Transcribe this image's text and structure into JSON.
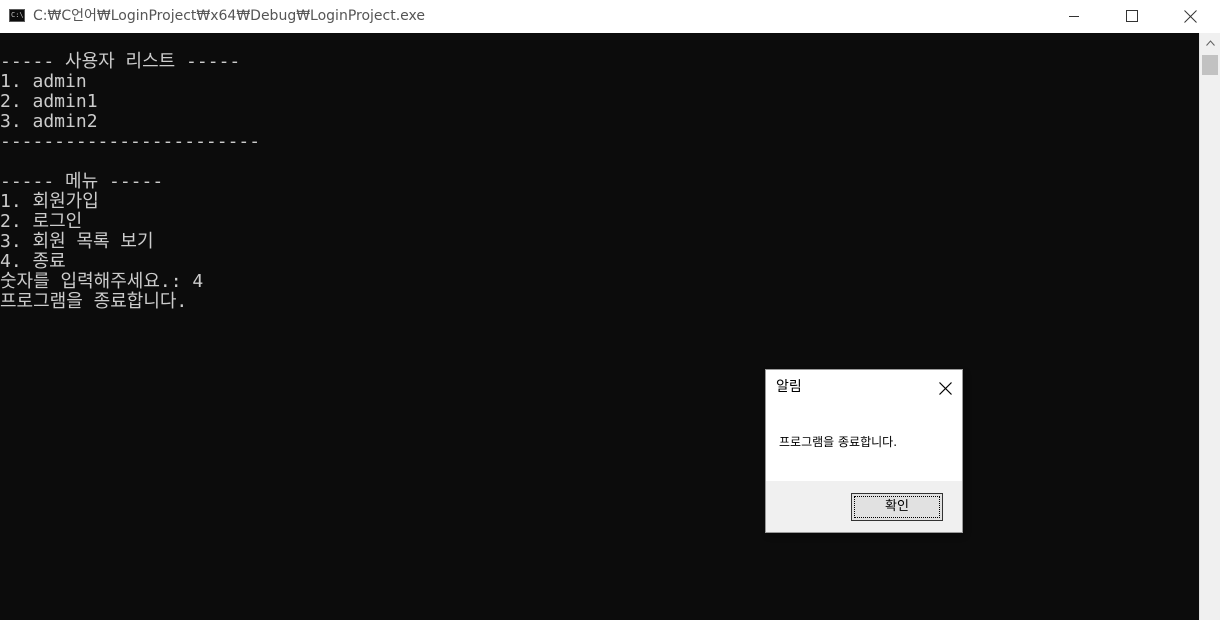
{
  "window": {
    "title": "C:₩C언어₩LoginProject₩x64₩Debug₩LoginProject.exe",
    "icon": "console-app-icon",
    "icon_text": "C:\\"
  },
  "console": {
    "lines": [
      "----- 사용자 리스트 -----",
      "1. admin",
      "2. admin1",
      "3. admin2",
      "------------------------",
      "",
      "----- 메뉴 -----",
      "1. 회원가입",
      "2. 로그인",
      "3. 회원 목록 보기",
      "4. 종료",
      "숫자를 입력해주세요.: 4",
      "프로그램을 종료합니다."
    ]
  },
  "dialog": {
    "title": "알림",
    "message": "프로그램을 종료합니다.",
    "ok_label": "확인"
  },
  "colors": {
    "console_bg": "#0c0c0c",
    "console_fg": "#cccccc",
    "dialog_footer": "#f0f0f0"
  }
}
